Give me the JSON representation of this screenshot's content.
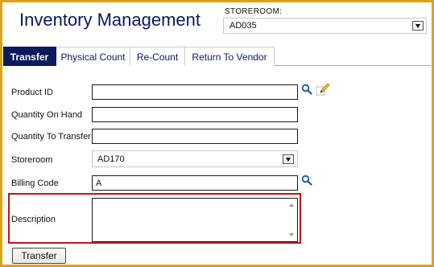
{
  "header": {
    "title": "Inventory Management",
    "storeroom_label": "STOREROOM:",
    "storeroom_value": "AD035"
  },
  "tabs": [
    {
      "label": "Transfer",
      "active": true
    },
    {
      "label": "Physical Count",
      "active": false
    },
    {
      "label": "Re-Count",
      "active": false
    },
    {
      "label": "Return To Vendor",
      "active": false
    }
  ],
  "form": {
    "product_id": {
      "label": "Product ID",
      "value": ""
    },
    "quantity_on_hand": {
      "label": "Quantity On Hand",
      "value": ""
    },
    "quantity_to_transfer": {
      "label": "Quantity To Transfer",
      "value": ""
    },
    "storeroom": {
      "label": "Storeroom",
      "value": "AD170"
    },
    "billing_code": {
      "label": "Billing Code",
      "value": "A"
    },
    "description": {
      "label": "Description",
      "value": ""
    }
  },
  "actions": {
    "transfer_label": "Transfer"
  },
  "icons": {
    "product_lookup": "search-icon",
    "product_edit": "edit-pencil-icon",
    "billing_lookup": "search-icon"
  },
  "colors": {
    "frame": "#d9a21b",
    "title_navy": "#0b1a5c",
    "active_tab": "#0b1a5c",
    "highlight_border": "#c0131b",
    "search_icon": "#1f5aa6"
  }
}
